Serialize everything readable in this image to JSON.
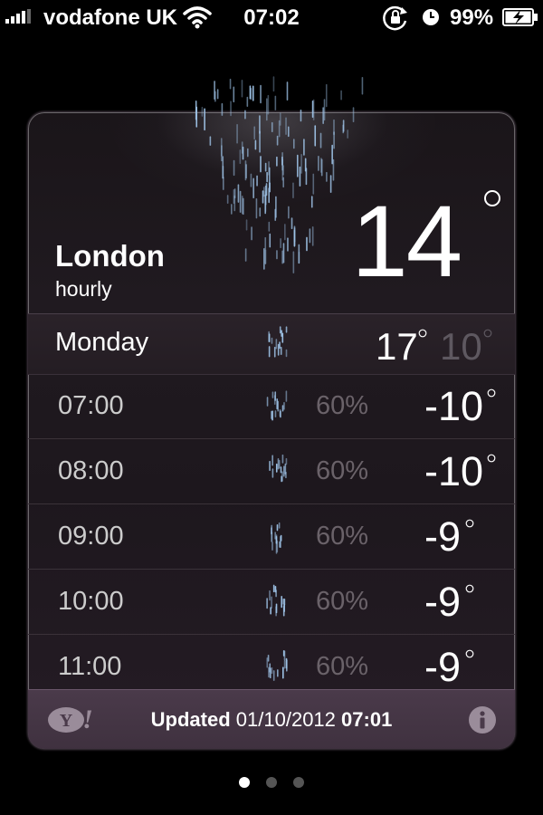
{
  "status_bar": {
    "carrier": "vodafone UK",
    "time": "07:02",
    "battery": "99%",
    "icons": [
      "signal-icon",
      "wifi-icon",
      "rotation-lock-icon",
      "alarm-icon",
      "battery-charging-icon"
    ]
  },
  "weather": {
    "city": "London",
    "view": "hourly",
    "current_temp": "14",
    "condition_icon": "rain-icon",
    "day": {
      "label": "Monday",
      "high": "17",
      "low": "10",
      "icon": "rain-icon"
    },
    "hours": [
      {
        "time": "07:00",
        "precip": "60%",
        "temp": "-10",
        "icon": "rain-icon"
      },
      {
        "time": "08:00",
        "precip": "60%",
        "temp": "-10",
        "icon": "rain-icon"
      },
      {
        "time": "09:00",
        "precip": "60%",
        "temp": "-9",
        "icon": "rain-icon"
      },
      {
        "time": "10:00",
        "precip": "60%",
        "temp": "-9",
        "icon": "rain-icon"
      },
      {
        "time": "11:00",
        "precip": "60%",
        "temp": "-9",
        "icon": "rain-icon"
      }
    ]
  },
  "footer": {
    "updated_label": "Updated",
    "updated_date": "01/10/2012",
    "updated_time": "07:01",
    "logo": "yahoo-logo",
    "info_icon": "info-icon"
  },
  "pager": {
    "pages": 3,
    "active": 0
  },
  "colors": {
    "background": "#000000",
    "card": "#201a20",
    "footer": "#4a3a4a",
    "rain": "#9fc4e8",
    "muted_text": "#6a6269"
  }
}
